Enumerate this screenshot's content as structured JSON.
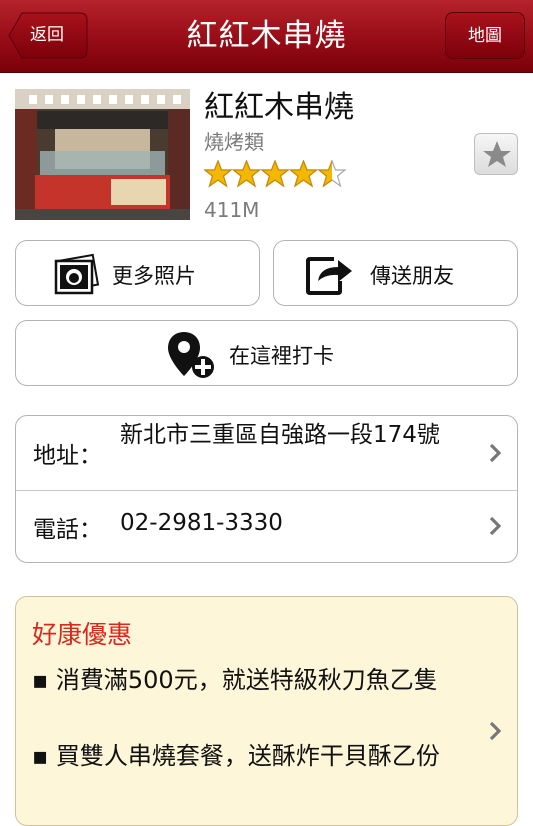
{
  "navbar": {
    "title": "紅紅木串燒",
    "back_label": "返回",
    "map_label": "地圖"
  },
  "place": {
    "name": "紅紅木串燒",
    "category": "燒烤類",
    "rating": 4.5,
    "rating_max": 5,
    "distance": "411M"
  },
  "actions": {
    "more_photos": "更多照片",
    "share_friend": "傳送朋友",
    "check_in": "在這裡打卡"
  },
  "info": {
    "address_label": "地址：",
    "address_value": "新北市三重區自強路一段174號",
    "phone_label": "電話：",
    "phone_value": "02-2981-3330"
  },
  "promotions": {
    "title": "好康優惠",
    "items": [
      "▪ 消費滿500元，就送特級秋刀魚乙隻",
      "▪ 買雙人串燒套餐，送酥炸干貝酥乙份"
    ]
  },
  "colors": {
    "navbar": "#9a0e18",
    "star": "#f5b800",
    "promo_bg": "#fdf6d8",
    "promo_title": "#d8291f"
  }
}
